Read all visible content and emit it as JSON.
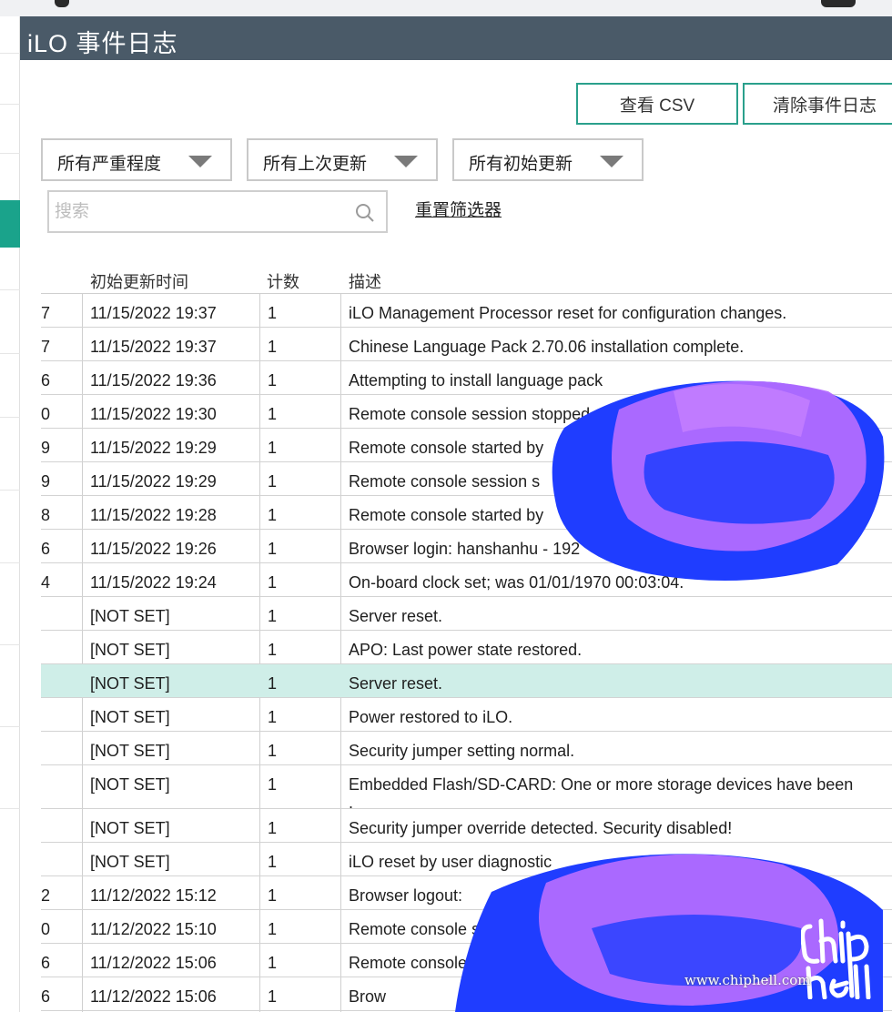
{
  "page": {
    "title": "iLO 事件日志"
  },
  "toolbar": {
    "view_csv": "查看 CSV",
    "clear_log": "清除事件日志"
  },
  "filters": {
    "severity": "所有严重程度",
    "last_update": "所有上次更新",
    "initial_update": "所有初始更新",
    "search_placeholder": "搜索",
    "reset": "重置筛选器"
  },
  "table": {
    "headers": {
      "initial_update": "初始更新时间",
      "count": "计数",
      "description": "描述"
    },
    "rows": [
      {
        "prefix": "7",
        "time": "11/15/2022 19:37",
        "count": "1",
        "desc": "iLO Management Processor reset for configuration changes."
      },
      {
        "prefix": "7",
        "time": "11/15/2022 19:37",
        "count": "1",
        "desc": "Chinese Language Pack 2.70.06 installation complete."
      },
      {
        "prefix": "6",
        "time": "11/15/2022 19:36",
        "count": "1",
        "desc": "Attempting to install language pack"
      },
      {
        "prefix": "0",
        "time": "11/15/2022 19:30",
        "count": "1",
        "desc": "Remote console session stopped"
      },
      {
        "prefix": "9",
        "time": "11/15/2022 19:29",
        "count": "1",
        "desc": "Remote console started by"
      },
      {
        "prefix": "9",
        "time": "11/15/2022 19:29",
        "count": "1",
        "desc": "Remote console session s"
      },
      {
        "prefix": "8",
        "time": "11/15/2022 19:28",
        "count": "1",
        "desc": "Remote console started by"
      },
      {
        "prefix": "6",
        "time": "11/15/2022 19:26",
        "count": "1",
        "desc": "Browser login: hanshanhu - 192"
      },
      {
        "prefix": "4",
        "time": "11/15/2022 19:24",
        "count": "1",
        "desc": "On-board clock set; was 01/01/1970  00:03:04."
      },
      {
        "prefix": "",
        "time": "[NOT SET]",
        "count": "1",
        "desc": "Server reset."
      },
      {
        "prefix": "",
        "time": "[NOT SET]",
        "count": "1",
        "desc": "APO: Last power state restored."
      },
      {
        "prefix": "",
        "time": "[NOT SET]",
        "count": "1",
        "desc": "Server reset."
      },
      {
        "prefix": "",
        "time": "[NOT SET]",
        "count": "1",
        "desc": "Power restored to iLO."
      },
      {
        "prefix": "",
        "time": "[NOT SET]",
        "count": "1",
        "desc": "Security jumper setting normal."
      },
      {
        "prefix": "",
        "time": "[NOT SET]",
        "count": "1",
        "desc": "Embedded Flash/SD-CARD: One or more storage devices have been",
        "extra": "."
      },
      {
        "prefix": "",
        "time": "[NOT SET]",
        "count": "1",
        "desc": "Security jumper override detected.  Security disabled!"
      },
      {
        "prefix": "",
        "time": "[NOT SET]",
        "count": "1",
        "desc": "iLO reset by user diagnostic"
      },
      {
        "prefix": "2",
        "time": "11/12/2022 15:12",
        "count": "1",
        "desc": "Browser logout:"
      },
      {
        "prefix": "0",
        "time": "11/12/2022 15:10",
        "count": "1",
        "desc": "Remote console sessi"
      },
      {
        "prefix": "6",
        "time": "11/12/2022 15:06",
        "count": "1",
        "desc": "Remote console started"
      },
      {
        "prefix": "6",
        "time": "11/12/2022 15:06",
        "count": "1",
        "desc": "Brow"
      }
    ],
    "highlighted_row": 11
  },
  "watermark": {
    "url": "www.chiphell.com",
    "logo": "chip hell"
  },
  "colors": {
    "titlebar": "#4a5a68",
    "accent": "#1aa38b",
    "highlight_row": "#cfeee8",
    "scribble_blue": "#1f3dff",
    "scribble_purple": "#b26bff"
  }
}
